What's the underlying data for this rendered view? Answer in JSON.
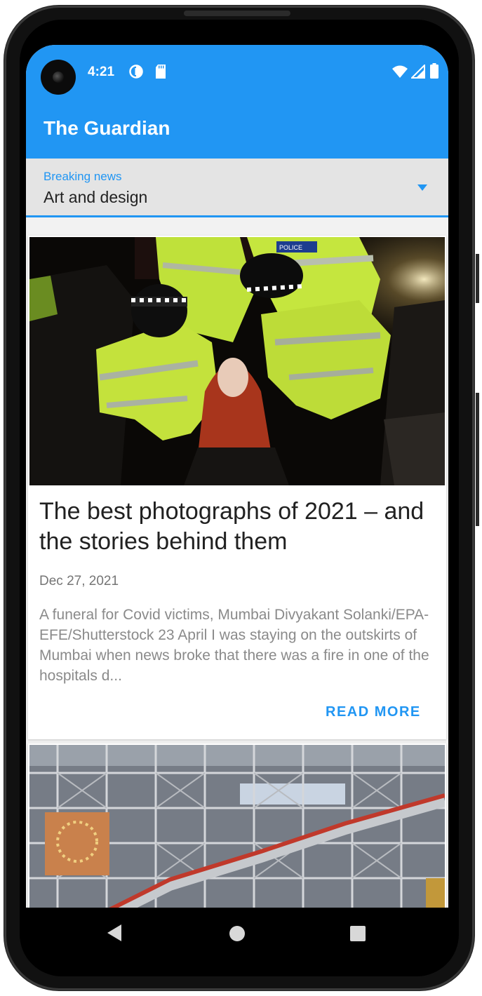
{
  "status_bar": {
    "time": "4:21",
    "icons": [
      "data-saver-icon",
      "sd-card-icon",
      "wifi-icon",
      "signal-icon",
      "battery-icon"
    ]
  },
  "app_bar": {
    "title": "The Guardian"
  },
  "section_selector": {
    "label": "Breaking news",
    "value": "Art and design"
  },
  "articles": [
    {
      "headline": "The best photographs of 2021 – and the stories behind them",
      "date": "Dec 27, 2021",
      "summary": "A funeral for Covid victims, Mumbai Divyakant Solanki/EPA-EFE/Shutterstock 23 April I was staying on the outskirts of Mumbai when news broke that there was a fire in one of the hospitals d...",
      "action": "READ MORE"
    }
  ],
  "nav_bar": {
    "buttons": [
      "back-icon",
      "home-icon",
      "recents-icon"
    ]
  },
  "colors": {
    "accent": "#2196f3",
    "background": "#f2f2f2"
  }
}
